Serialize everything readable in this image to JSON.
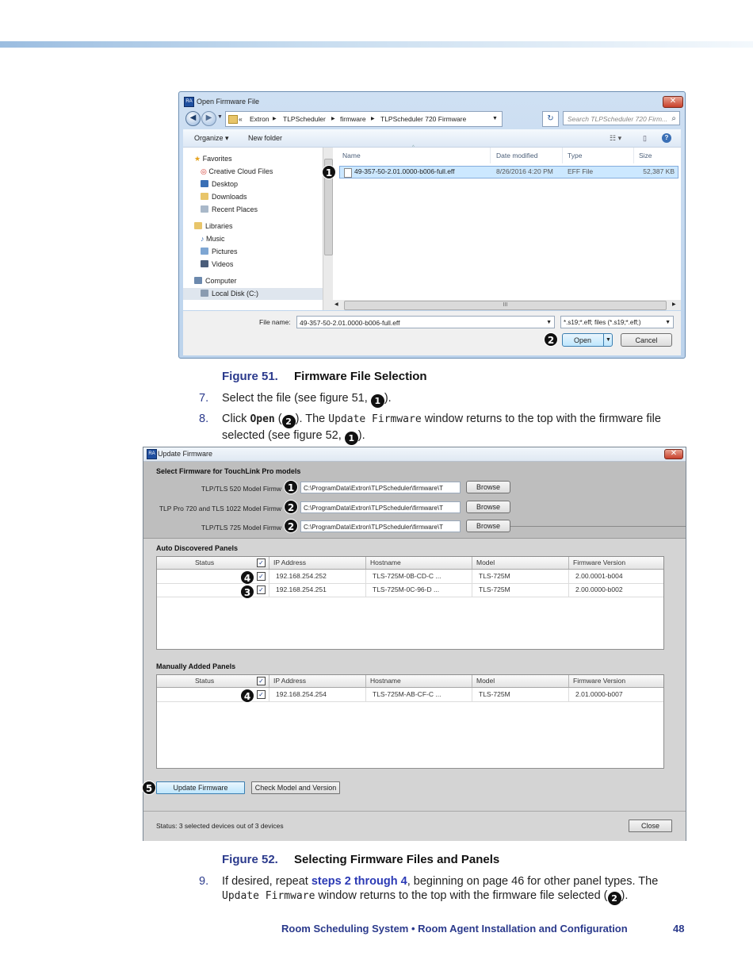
{
  "dialog1": {
    "title": "Open Firmware File",
    "app_icon": "RA",
    "address": {
      "prefix": "«",
      "segments": [
        "Extron",
        "TLPScheduler",
        "firmware",
        "TLPScheduler 720 Firmware"
      ]
    },
    "search_placeholder": "Search TLPScheduler 720 Firm...",
    "toolbar": {
      "organize": "Organize ▾",
      "new_folder": "New folder"
    },
    "nav": {
      "favorites": "Favorites",
      "favorites_items": [
        "Creative Cloud Files",
        "Desktop",
        "Downloads",
        "Recent Places"
      ],
      "libraries": "Libraries",
      "libraries_items": [
        "Music",
        "Pictures",
        "Videos"
      ],
      "computer": "Computer",
      "computer_items": [
        "Local Disk (C:)"
      ]
    },
    "columns": {
      "name": "Name",
      "date": "Date modified",
      "type": "Type",
      "size": "Size"
    },
    "file": {
      "name": "49-357-50-2.01.0000-b006-full.eff",
      "date": "8/26/2016 4:20 PM",
      "type": "EFF File",
      "size": "52,387 KB"
    },
    "file_name_label": "File name:",
    "file_name_value": "49-357-50-2.01.0000-b006-full.eff",
    "filter_value": "*.s19;*.eff; files (*.s19;*.eff;)",
    "open_label": "Open",
    "cancel_label": "Cancel",
    "hscroll_grip": "III",
    "callouts": {
      "file": "1",
      "open": "2"
    }
  },
  "figure51": {
    "number": "Figure 51.",
    "title": "Firmware File Selection"
  },
  "step7": {
    "number": "7.",
    "text": "Select the file (see figure 51, ",
    "callout": "1",
    "end": ")."
  },
  "step8": {
    "number": "8.",
    "pre": "Click ",
    "open": "Open",
    "mid1": " (",
    "callout1": "2",
    "mid2": "). The ",
    "window": "Update Firmware",
    "mid3": " window returns to the top with the firmware file selected (see figure 52, ",
    "callout2": "1",
    "end": ")."
  },
  "dialog2": {
    "title": "Update Firmware",
    "app_icon": "RA",
    "section_select": "Select Firmware for TouchLink Pro models",
    "model_rows": [
      {
        "label": "TLP/TLS 520 Model Firmw",
        "path": "C:\\ProgramData\\Extron\\TLPScheduler\\firmware\\T",
        "browse": "Browse",
        "callout": "1"
      },
      {
        "label": "TLP Pro 720 and TLS 1022 Model Firmw",
        "path": "C:\\ProgramData\\Extron\\TLPScheduler\\firmware\\T",
        "browse": "Browse",
        "callout": "2"
      },
      {
        "label": "TLP/TLS 725 Model Firmw",
        "path": "C:\\ProgramData\\Extron\\TLPScheduler\\firmware\\T",
        "browse": "Browse",
        "callout": "2"
      }
    ],
    "section_auto": "Auto Discovered Panels",
    "section_manual": "Manually Added Panels",
    "columns": {
      "status": "Status",
      "ip": "IP Address",
      "host": "Hostname",
      "model": "Model",
      "fw": "Firmware Version"
    },
    "check_mark": "✓",
    "auto_rows": [
      {
        "ip": "192.168.254.252",
        "host": "TLS-725M-0B-CD-C ...",
        "model": "TLS-725M",
        "fw": "2.00.0001-b004",
        "callout": "4"
      },
      {
        "ip": "192.168.254.251",
        "host": "TLS-725M-0C-96-D ...",
        "model": "TLS-725M",
        "fw": "2.00.0000-b002",
        "callout": "3"
      }
    ],
    "manual_rows": [
      {
        "ip": "192.168.254.254",
        "host": "TLS-725M-AB-CF-C ...",
        "model": "TLS-725M",
        "fw": "2.01.0000-b007",
        "callout": "4"
      }
    ],
    "update_button": "Update Firmware",
    "update_callout": "5",
    "check_button": "Check Model and Version",
    "status_text": "Status: 3 selected devices out of 3 devices",
    "close_button": "Close"
  },
  "figure52": {
    "number": "Figure 52.",
    "title": "Selecting Firmware Files and Panels"
  },
  "step9": {
    "number": "9.",
    "pre": "If desired, repeat ",
    "link": "steps 2 through 4",
    "mid": ", beginning on page 46 for other panel types. The ",
    "window": "Update Firmware",
    "mid2": " window returns to the top with the firmware file selected (",
    "callout": "2",
    "end": ")."
  },
  "footer": {
    "text": "Room Scheduling System • Room Agent Installation and Configuration",
    "page": "48"
  }
}
